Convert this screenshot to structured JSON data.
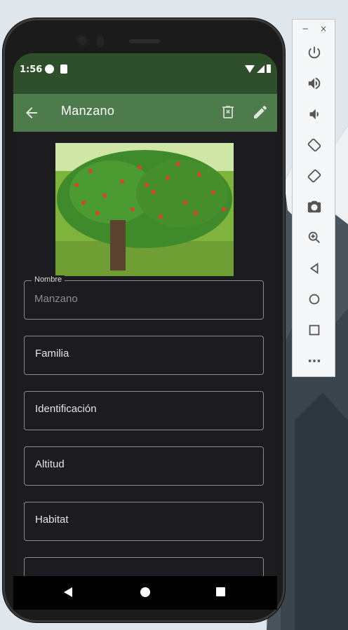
{
  "status_bar": {
    "time": "1:56"
  },
  "app_bar": {
    "title": "Manzano"
  },
  "form": {
    "nombre_label": "Nombre",
    "nombre_value": "Manzano",
    "familia_label": "Familia",
    "identificacion_label": "Identificación",
    "altitud_label": "Altitud",
    "habitat_label": "Habitat"
  },
  "colors": {
    "status_bar": "#2f4f2c",
    "app_bar": "#4e7b4c",
    "screen_bg": "#1c1b1f"
  },
  "icons": {
    "back": "arrow-left-icon",
    "delete": "delete-icon",
    "edit": "pencil-icon"
  },
  "emulator_toolbar": {
    "minimize": "−",
    "close": "×",
    "buttons": [
      "power-icon",
      "volume-up-icon",
      "volume-down-icon",
      "rotate-left-icon",
      "rotate-right-icon",
      "camera-icon",
      "zoom-in-icon",
      "back-triangle-icon",
      "home-circle-icon",
      "overview-square-icon",
      "more-icon"
    ]
  }
}
